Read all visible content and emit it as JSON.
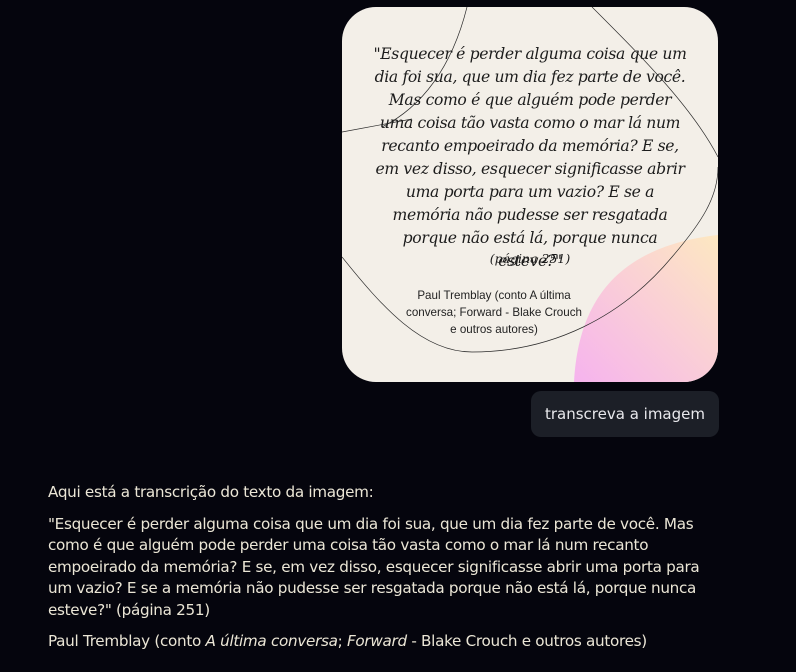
{
  "image_card": {
    "quote": "\"Esquecer é perder alguma coisa que um dia foi sua, que um dia fez parte de você. Mas como é que alguém pode perder uma coisa tão vasta como o mar lá num recanto empoeirado da memória? E se, em vez disso, esquecer significasse abrir uma porta para um vazio? E se a memória não pudesse ser resgatada porque não está lá, porque nunca esteve?\"",
    "page": "(página  251)",
    "author": "Paul Tremblay (conto A última conversa; Forward - Blake Crouch e outros autores)",
    "gradient_colors": [
      "#f6b3ee",
      "#fde8c1"
    ]
  },
  "user_message": {
    "text": "transcreva a imagem"
  },
  "assistant": {
    "intro": "Aqui está a transcrição do texto da imagem:",
    "quote": "\"Esquecer é perder alguma coisa que um dia foi sua, que um dia fez parte de você. Mas como é que alguém pode perder uma coisa tão vasta como o mar lá num recanto empoeirado da memória? E se, em vez disso, esquecer significasse abrir uma porta para um vazio? E se a memória não pudesse ser resgatada porque não está lá, porque nunca esteve?\" (página 251)",
    "author_prefix": "Paul Tremblay (conto ",
    "author_title": "A última conversa",
    "author_sep": "; ",
    "author_book": "Forward",
    "author_suffix": " - Blake Crouch e outros autores)"
  }
}
